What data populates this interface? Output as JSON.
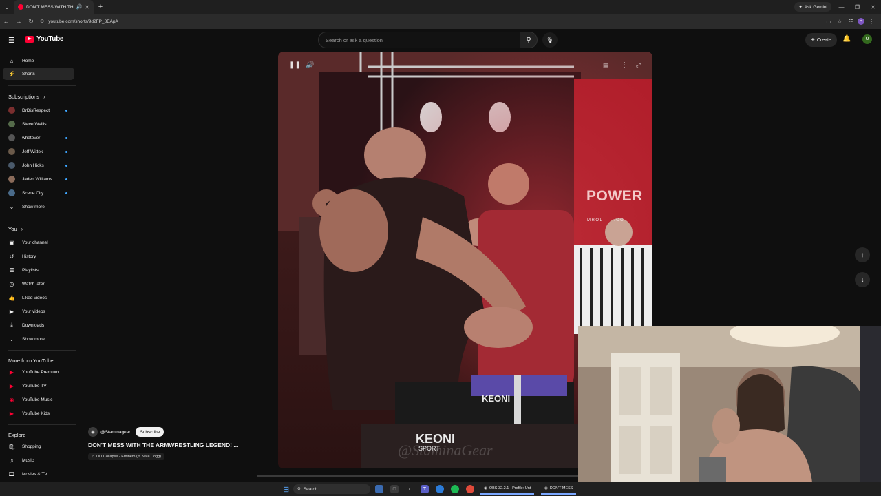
{
  "browser": {
    "tab_title": "DON'T MESS WITH THE AR",
    "ask_gemini": "Ask Gemini",
    "url": "youtube.com/shorts/9d2FP_8EApA"
  },
  "header": {
    "logo_text": "YouTube",
    "search_placeholder": "Search or ask a question",
    "create_label": "Create",
    "avatar_letter": "U"
  },
  "sidebar": {
    "home": "Home",
    "shorts": "Shorts",
    "subscriptions_heading": "Subscriptions",
    "subscriptions": [
      {
        "label": "DrDisRespect",
        "color": "#7a2e2e"
      },
      {
        "label": "Steve Wallis",
        "color": "#556b4a"
      },
      {
        "label": "whatever",
        "color": "#555555"
      },
      {
        "label": "Jeff Wittek",
        "color": "#6b5a4a"
      },
      {
        "label": "John Hicks",
        "color": "#4a5a6b"
      },
      {
        "label": "Jaden Williams",
        "color": "#8a6b5a"
      },
      {
        "label": "Scene City",
        "color": "#4a6b8a"
      }
    ],
    "show_more_1": "Show more",
    "you_heading": "You",
    "you_items": [
      "Your channel",
      "History",
      "Playlists",
      "Watch later",
      "Liked videos",
      "Your videos",
      "Downloads"
    ],
    "show_more_2": "Show more",
    "more_heading": "More from YouTube",
    "more_items": [
      "YouTube Premium",
      "YouTube TV",
      "YouTube Music",
      "YouTube Kids"
    ],
    "explore_heading": "Explore",
    "explore_items": [
      "Shopping",
      "Music",
      "Movies & TV"
    ]
  },
  "short": {
    "channel": "@Staminagear",
    "subscribe_label": "Subscribe",
    "title": "DON'T MESS WITH THE ARMWRESTLING LEGEND! ...",
    "music": "Till I Collapse - Eminem (ft. Nate Dogg)",
    "banner_text": "POWER",
    "banner_sub": "MROL     .CO",
    "table_brand": "KEONI",
    "table_brand_sub": "SPORT",
    "watermark": "@StaminaGear"
  },
  "taskbar": {
    "search_label": "Search",
    "obs_label": "OBS 32.2.1 - Profile: Unt",
    "chrome_label": "DON'T MESS"
  },
  "colors": {
    "accent": "#ff0033",
    "link": "#3ea6ff"
  }
}
